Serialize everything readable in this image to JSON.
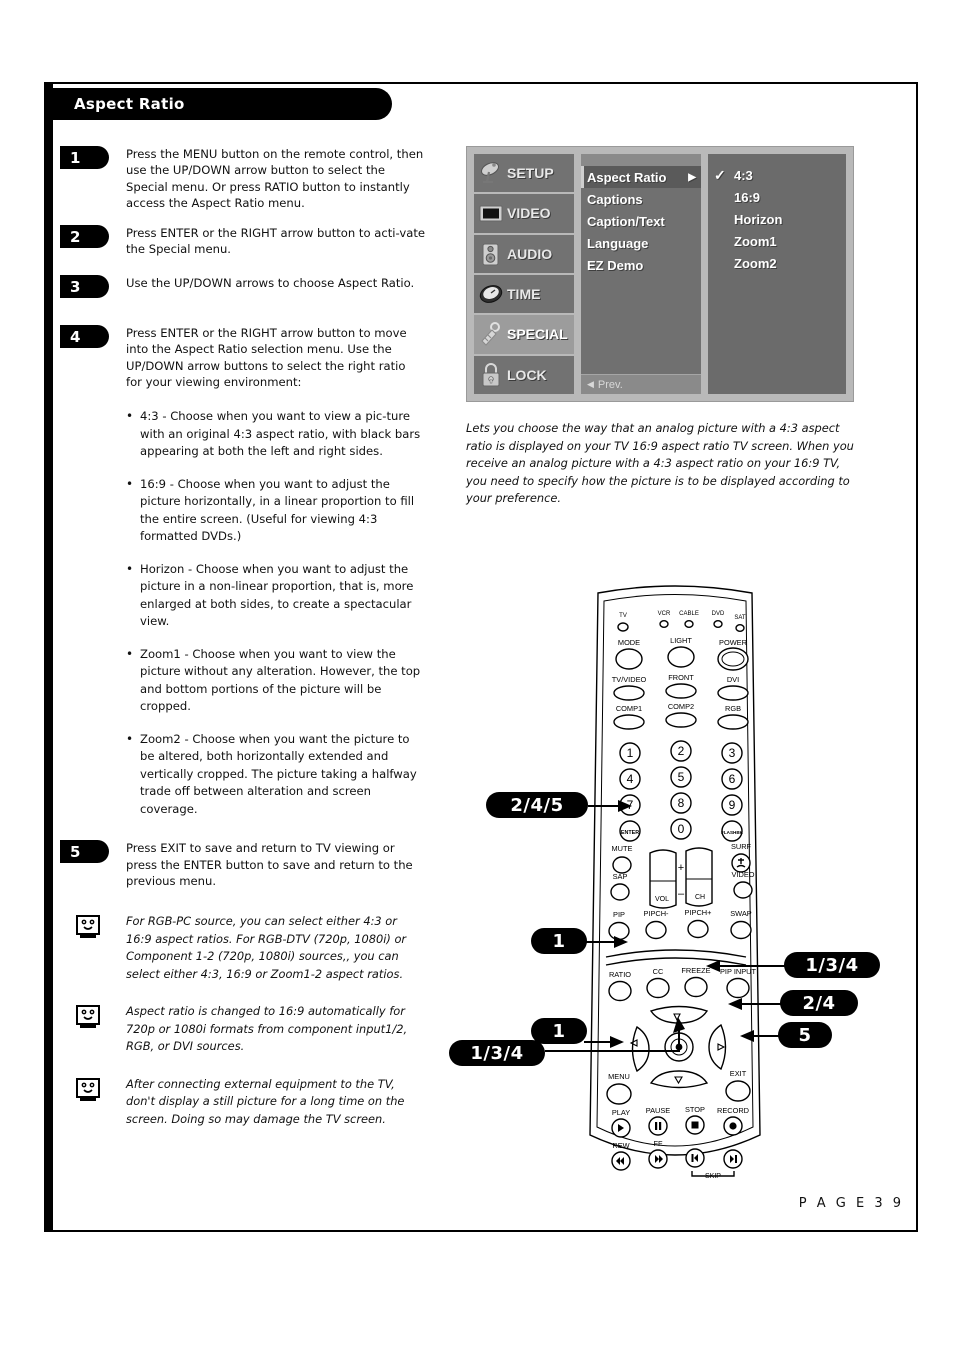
{
  "page": {
    "title": "Aspect Ratio",
    "footer": "P A G E   3 9"
  },
  "steps": [
    {
      "num": "1",
      "text": "Press the MENU button on the remote control, then use the UP/DOWN arrow button to select the Special menu. Or press RATIO button to instantly access the Aspect Ratio menu."
    },
    {
      "num": "2",
      "text": "Press ENTER or the RIGHT arrow button to acti-vate the Special menu."
    },
    {
      "num": "3",
      "text": "Use the UP/DOWN arrows to choose Aspect Ratio."
    },
    {
      "num": "4",
      "text": "Press ENTER or the RIGHT arrow button to move into the Aspect Ratio selection menu. Use the UP/DOWN arrow buttons to select the right ratio for your viewing environment:"
    }
  ],
  "bullets": [
    "4:3 - Choose when you want to view a pic-ture with an original 4:3 aspect ratio, with black bars appearing at both the left and right sides.",
    "16:9 - Choose when you want to adjust the picture horizontally, in a linear proportion to fill the entire screen. (Useful for viewing 4:3 formatted DVDs.)",
    "Horizon - Choose when you want to adjust the picture in a non-linear proportion, that is, more enlarged at both sides, to create a spectacular view.",
    "Zoom1 - Choose when you want to view the picture without any alteration. However, the top and bottom portions of the picture will be cropped.",
    "Zoom2 - Choose when you want the picture to be altered, both horizontally extended and vertically cropped. The picture taking a halfway trade off between alteration and screen coverage."
  ],
  "step5": {
    "num": "5",
    "text": "Press EXIT to save and return to TV viewing or press the ENTER button to save and return to the previous menu."
  },
  "notes": [
    "For RGB-PC source, you can select either 4:3 or 16:9 aspect ratios. For RGB-DTV (720p, 1080i) or Component 1-2 (720p, 1080i) sources,, you can select either 4:3, 16:9 or Zoom1-2 aspect ratios.",
    "Aspect ratio is changed to 16:9 automatically for 720p or 1080i formats from component input1/2, RGB, or DVI sources.",
    "After connecting external equipment to the TV, don't display a still picture for a long time on the screen. Doing so may damage the TV screen."
  ],
  "osd": {
    "categories": [
      {
        "label": "SETUP",
        "icon": "satellite-dish-icon",
        "selected": false
      },
      {
        "label": "VIDEO",
        "icon": "tv-screen-icon",
        "selected": false
      },
      {
        "label": "AUDIO",
        "icon": "speaker-icon",
        "selected": false
      },
      {
        "label": "TIME",
        "icon": "clock-icon",
        "selected": false
      },
      {
        "label": "SPECIAL",
        "icon": "key-icon",
        "selected": true
      },
      {
        "label": "LOCK",
        "icon": "padlock-icon",
        "selected": false
      }
    ],
    "items": [
      {
        "label": "Aspect Ratio",
        "arrow": "▶",
        "selected": true
      },
      {
        "label": "Captions",
        "arrow": "",
        "selected": false
      },
      {
        "label": "Caption/Text",
        "arrow": "",
        "selected": false
      },
      {
        "label": "Language",
        "arrow": "",
        "selected": false
      },
      {
        "label": "EZ Demo",
        "arrow": "",
        "selected": false
      }
    ],
    "prev_label": "Prev.",
    "prev_arrow": "◀",
    "options": [
      {
        "label": "4:3",
        "checked": true
      },
      {
        "label": "16:9",
        "checked": false
      },
      {
        "label": "Horizon",
        "checked": false
      },
      {
        "label": "Zoom1",
        "checked": false
      },
      {
        "label": "Zoom2",
        "checked": false
      }
    ],
    "check_glyph": "✓",
    "description": "Lets you choose the way that an analog picture with a 4:3 aspect ratio is displayed on your TV 16:9 aspect ratio TV screen. When you receive an analog picture with a 4:3 aspect ratio on your 16:9 TV, you need to specify how the picture is to be displayed according to your preference."
  },
  "remote": {
    "device_leds": [
      "TV",
      "VCR",
      "CABLE",
      "DVD",
      "SAT"
    ],
    "row_mode": [
      "MODE",
      "LIGHT",
      "POWER"
    ],
    "row_input1": [
      "TV/VIDEO",
      "FRONT",
      "DVI"
    ],
    "row_input2": [
      "COMP1",
      "COMP2",
      "RGB"
    ],
    "keypad": [
      "1",
      "2",
      "3",
      "4",
      "5",
      "6",
      "7",
      "8",
      "9",
      "ENTER",
      "0",
      "FLASHBK"
    ],
    "mute": "MUTE",
    "surf": "SURF",
    "sap": "SAP",
    "video": "VIDEO",
    "vol": "VOL",
    "ch": "CH",
    "plus": "+",
    "minus": "–",
    "row_pip": [
      "PIP",
      "PIPCH-",
      "PIPCH+",
      "SWAP"
    ],
    "row_ratio": [
      "RATIO",
      "CC",
      "FREEZE",
      "PIP INPUT"
    ],
    "menu": "MENU",
    "exit": "EXIT",
    "transport_top": [
      "PLAY",
      "PAUSE",
      "STOP",
      "RECORD"
    ],
    "transport_bottom": [
      "REW",
      "FF"
    ],
    "skip": "SKIP"
  },
  "callouts": [
    {
      "id": "callout-enter",
      "label": "2/4/5"
    },
    {
      "id": "callout-ratio",
      "label": "1"
    },
    {
      "id": "callout-up",
      "label": "1/3/4"
    },
    {
      "id": "callout-right",
      "label": "2/4"
    },
    {
      "id": "callout-exit",
      "label": "5"
    },
    {
      "id": "callout-menu",
      "label": "1"
    },
    {
      "id": "callout-down",
      "label": "1/3/4"
    }
  ]
}
